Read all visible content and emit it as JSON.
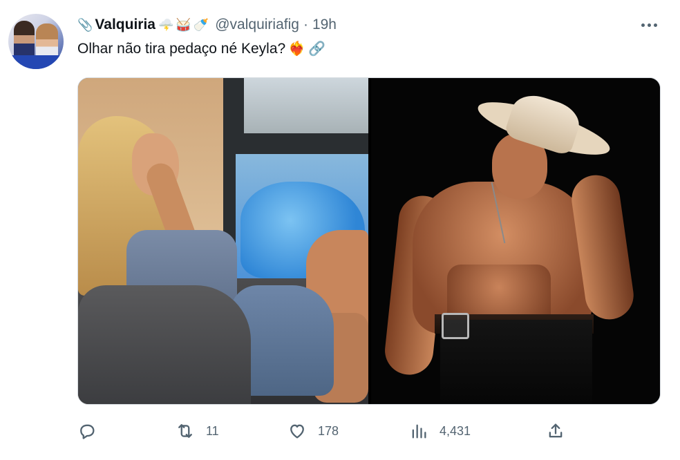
{
  "tweet": {
    "display_name": "Valquiria",
    "handle": "@valquiriafig",
    "separator": "·",
    "time": "19h",
    "name_emojis": [
      "🌩️",
      "🥁",
      "🍼"
    ],
    "text": "Olhar não tira pedaço né Keyla?",
    "text_emojis": [
      "❤️‍🔥",
      "🔗"
    ],
    "name_prefix_emoji": "📎"
  },
  "media": {
    "count": 2,
    "items": [
      "left-photo",
      "right-photo"
    ]
  },
  "actions": {
    "reply_count": "",
    "retweet_count": "11",
    "like_count": "178",
    "views_count": "4,431",
    "share_count": ""
  },
  "icons": {
    "reply": "reply-icon",
    "retweet": "retweet-icon",
    "like": "heart-icon",
    "views": "analytics-icon",
    "share": "share-icon",
    "more": "more-icon"
  },
  "colors": {
    "text": "#0f1419",
    "muted": "#536471",
    "background": "#ffffff",
    "border": "#d6dbe0"
  }
}
